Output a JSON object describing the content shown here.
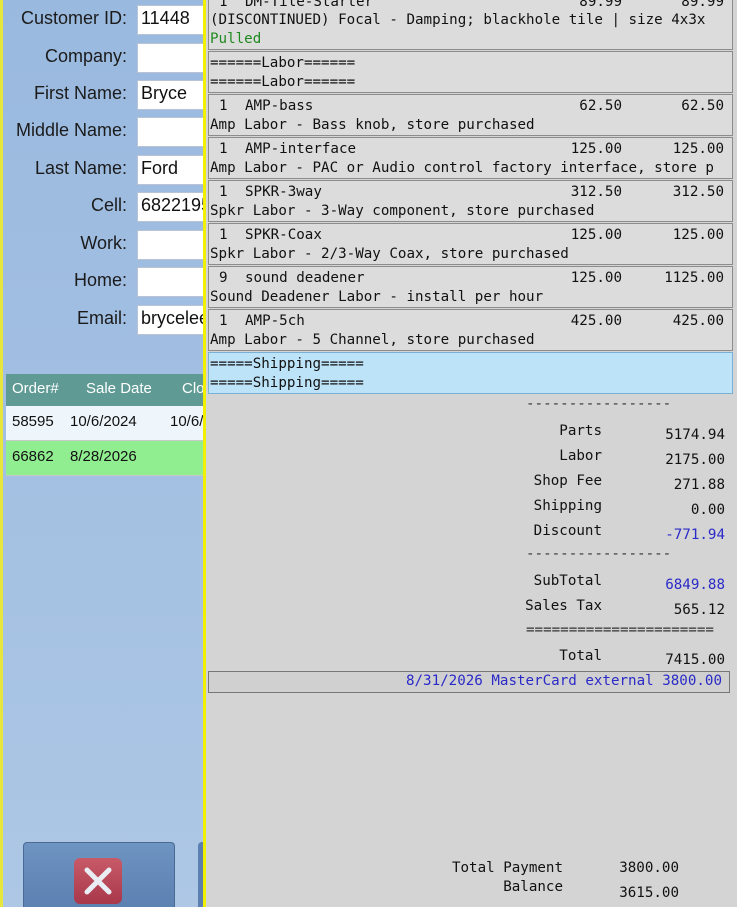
{
  "customer": {
    "fields": [
      {
        "label": "Customer ID:",
        "value": "11448"
      },
      {
        "label": "Company:",
        "value": ""
      },
      {
        "label": "First Name:",
        "value": "Bryce"
      },
      {
        "label": "Middle Name:",
        "value": ""
      },
      {
        "label": "Last Name:",
        "value": "Ford"
      },
      {
        "label": "Cell:",
        "value": "6822195"
      },
      {
        "label": "Work:",
        "value": ""
      },
      {
        "label": "Home:",
        "value": ""
      },
      {
        "label": "Email:",
        "value": "brycelee"
      }
    ]
  },
  "orders": {
    "headers": [
      "Order#",
      "Sale Date",
      "Clo"
    ],
    "rows": [
      {
        "order": "58595",
        "sale_date": "10/6/2024",
        "close": "10/6/",
        "bg": "#eef6fc"
      },
      {
        "order": "66862",
        "sale_date": "8/28/2026",
        "close": "",
        "bg": "#90ee90"
      }
    ]
  },
  "receipt": {
    "top_item": {
      "line1_qty": "1",
      "line1_code": "DM-Tile-Starter",
      "line1_price": "89.99",
      "line1_total": "89.99",
      "line2": "(DISCONTINUED) Focal - Damping; blackhole tile | size 4x3x",
      "status": "Pulled"
    },
    "labor_header": [
      "======Labor======",
      "======Labor======"
    ],
    "items": [
      {
        "qty": "1",
        "code": "AMP-bass",
        "price": "62.50",
        "total": "62.50",
        "desc": "Amp Labor - Bass knob, store purchased"
      },
      {
        "qty": "1",
        "code": "AMP-interface",
        "price": "125.00",
        "total": "125.00",
        "desc": "Amp Labor - PAC or Audio control factory interface, store p"
      },
      {
        "qty": "1",
        "code": "SPKR-3way",
        "price": "312.50",
        "total": "312.50",
        "desc": "Spkr Labor - 3-Way component, store purchased"
      },
      {
        "qty": "1",
        "code": "SPKR-Coax",
        "price": "125.00",
        "total": "125.00",
        "desc": "Spkr Labor - 2/3-Way Coax, store purchased"
      },
      {
        "qty": "9",
        "code": "sound deadener",
        "price": "125.00",
        "total": "1125.00",
        "desc": "Sound Deadener Labor - install per hour"
      },
      {
        "qty": "1",
        "code": "AMP-5ch",
        "price": "425.00",
        "total": "425.00",
        "desc": "Amp Labor - 5 Channel, store purchased"
      }
    ],
    "shipping_header": [
      "=====Shipping=====",
      "=====Shipping====="
    ],
    "separator_short": "-----------------",
    "separator_double": "======================",
    "totals": [
      {
        "label": "Parts",
        "value": "5174.94",
        "blue": false
      },
      {
        "label": "Labor",
        "value": "2175.00",
        "blue": false
      },
      {
        "label": "Shop Fee",
        "value": "271.88",
        "blue": false
      },
      {
        "label": "Shipping",
        "value": "0.00",
        "blue": false
      },
      {
        "label": "Discount",
        "value": "-771.94",
        "blue": true
      }
    ],
    "subtotal": {
      "label": "SubTotal",
      "value": "6849.88"
    },
    "sales_tax": {
      "label": "Sales Tax",
      "value": "565.12"
    },
    "total": {
      "label": "Total",
      "value": "7415.00"
    },
    "payment": "8/31/2026 MasterCard external 3800.00",
    "total_payment": {
      "label": "Total Payment",
      "value": "3800.00"
    },
    "balance": {
      "label": "Balance",
      "value": "3615.00"
    }
  },
  "colors": {
    "highlight_shipping": "#bde3f8",
    "panel_border": "#f0f000",
    "blue_text": "#2a2ac8"
  },
  "icons": {
    "cancel": "close-x-icon"
  }
}
